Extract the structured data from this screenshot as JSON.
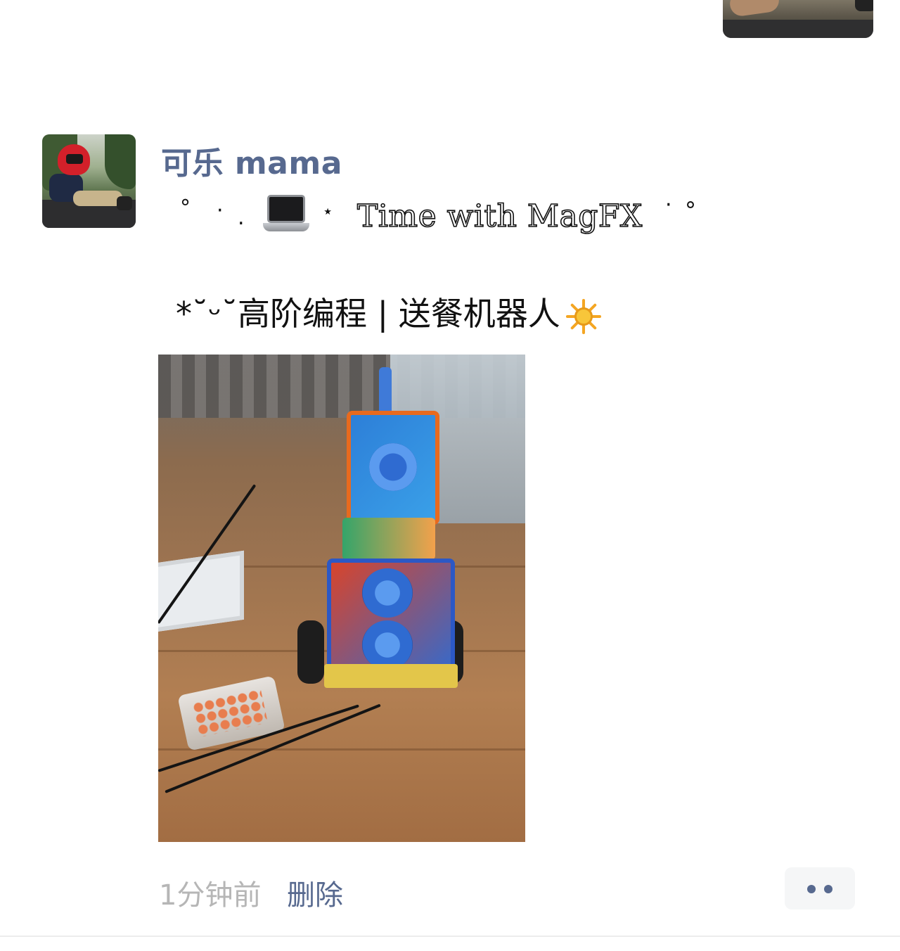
{
  "post": {
    "username": "可乐 mama",
    "line1": {
      "prefix_decorations": [
        "°",
        "·",
        ".",
        "⋆",
        "·",
        "°"
      ],
      "emoji": "laptop",
      "text": "Time with MagFX"
    },
    "line2": {
      "prefix": "*˘ᵕ˘",
      "text": "高阶编程 | 送餐机器人",
      "emoji": "sun"
    },
    "photo": {
      "description_icon": "robot-photo"
    },
    "time_ago": "1分钟前",
    "delete_label": "删除",
    "more_icon": "more-dots-icon"
  },
  "colors": {
    "username": "#57698f",
    "time": "#b6b6b6",
    "divider": "#ececec"
  }
}
